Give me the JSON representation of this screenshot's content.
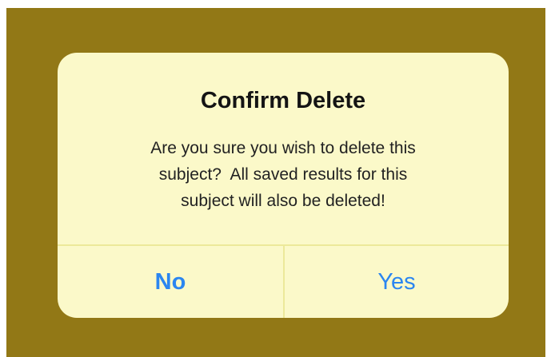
{
  "alert": {
    "title": "Confirm Delete",
    "message_lines": [
      "Are you sure you wish to delete this",
      "subject?  All saved results for this",
      "subject will also be deleted!"
    ],
    "buttons": {
      "no_label": "No",
      "yes_label": "Yes"
    }
  },
  "colors": {
    "backdrop": "#927816",
    "dialog_background": "#fbf9c9",
    "divider": "#ece99a",
    "button_text": "#2b86f0",
    "title_text": "#141414"
  }
}
